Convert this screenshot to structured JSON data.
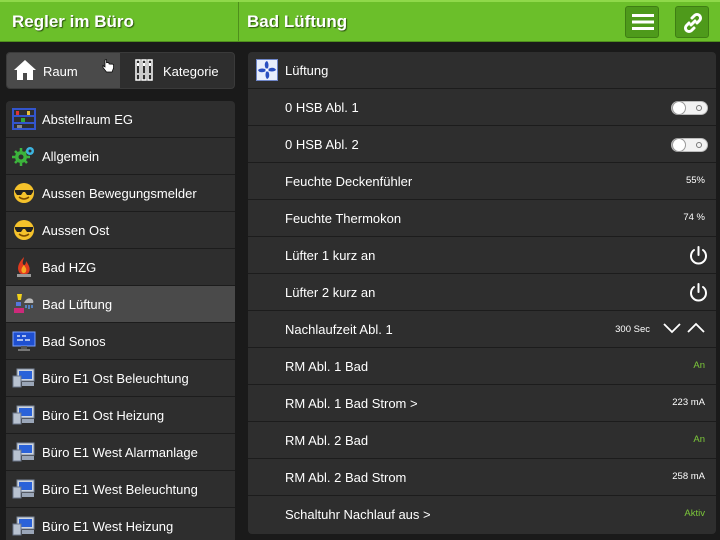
{
  "header": {
    "left_title": "Regler im Büro",
    "right_title": "Bad Lüftung",
    "menu_icon": "hamburger-menu-icon",
    "link_icon": "link-icon"
  },
  "filter": {
    "raum_label": "Raum",
    "kategorie_label": "Kategorie",
    "selected": "Raum"
  },
  "rooms": [
    {
      "label": "Abstellraum EG",
      "icon": "shelf-icon"
    },
    {
      "label": "Allgemein",
      "icon": "gears-icon"
    },
    {
      "label": "Aussen Bewegungsmelder",
      "icon": "sunglasses-smiley-icon"
    },
    {
      "label": "Aussen Ost",
      "icon": "sunglasses-smiley-icon"
    },
    {
      "label": "Bad HZG",
      "icon": "flame-icon"
    },
    {
      "label": "Bad Lüftung",
      "icon": "fan-shower-icon",
      "active": true
    },
    {
      "label": "Bad Sonos",
      "icon": "monitor-icon"
    },
    {
      "label": "Büro E1 Ost Beleuchtung",
      "icon": "computer-icon"
    },
    {
      "label": "Büro E1 Ost Heizung",
      "icon": "computer-icon"
    },
    {
      "label": "Büro E1 West Alarmanlage",
      "icon": "computer-icon"
    },
    {
      "label": "Büro E1 West Beleuchtung",
      "icon": "computer-icon"
    },
    {
      "label": "Büro E1 West Heizung",
      "icon": "computer-icon"
    }
  ],
  "panel": {
    "title": "Lüftung",
    "rows": [
      {
        "name": "0 HSB Abl. 1",
        "type": "toggle",
        "state": "off"
      },
      {
        "name": "0 HSB Abl. 2",
        "type": "toggle",
        "state": "off"
      },
      {
        "name": "Feuchte Deckenfühler",
        "type": "value",
        "value": "55%"
      },
      {
        "name": "Feuchte Thermokon",
        "type": "value",
        "value": "74 %"
      },
      {
        "name": "Lüfter 1 kurz an",
        "type": "power"
      },
      {
        "name": "Lüfter 2 kurz an",
        "type": "power"
      },
      {
        "name": "Nachlaufzeit Abl. 1",
        "type": "stepper",
        "value": "300 Sec"
      },
      {
        "name": "RM Abl. 1 Bad",
        "type": "status",
        "value": "An"
      },
      {
        "name": "RM Abl. 1 Bad Strom >",
        "type": "value",
        "value": "223 mA"
      },
      {
        "name": "RM Abl. 2 Bad",
        "type": "status",
        "value": "An"
      },
      {
        "name": "RM Abl. 2 Bad Strom",
        "type": "value",
        "value": "258 mA"
      },
      {
        "name": "Schaltuhr Nachlauf aus >",
        "type": "status",
        "value": "Aktiv"
      }
    ]
  },
  "colors": {
    "header_green": "#6bbf2a",
    "status_green": "#7cc83a",
    "panel_bg": "#2e2e2e",
    "active_row": "#4a4a4a"
  }
}
